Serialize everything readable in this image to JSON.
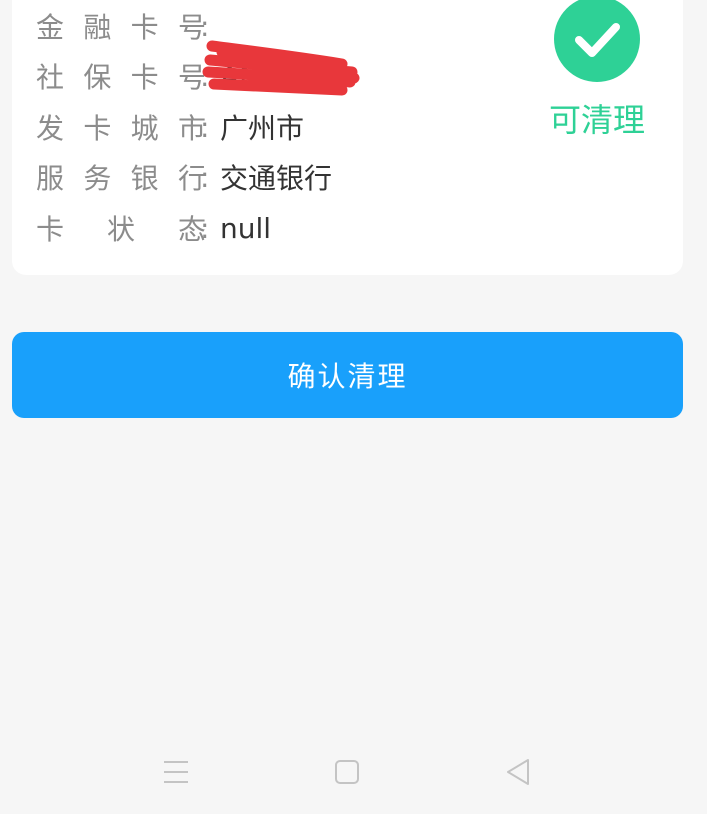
{
  "card": {
    "rows": [
      {
        "label_chars": [
          "金",
          "融",
          "卡",
          "号"
        ],
        "colon": ":",
        "value": ""
      },
      {
        "label_chars": [
          "社",
          "保",
          "卡",
          "号"
        ],
        "colon": ":",
        "value": "AN"
      },
      {
        "label_chars": [
          "发",
          "卡",
          "城",
          "市"
        ],
        "colon": ":",
        "value": "广州市"
      },
      {
        "label_chars": [
          "服",
          "务",
          "银",
          "行"
        ],
        "colon": ":",
        "value": "交通银行"
      },
      {
        "label_chars": [
          "卡",
          "状",
          "态"
        ],
        "colon": ":",
        "value": "null"
      }
    ],
    "status": {
      "icon": "check-icon",
      "text": "可清理",
      "color": "#2ed196"
    }
  },
  "confirm_button": {
    "label": "确认清理",
    "color": "#19a0fb"
  },
  "nav_bar": {
    "menu_icon": "menu-icon",
    "home_icon": "home-icon",
    "back_icon": "back-icon"
  },
  "colors": {
    "background": "#f6f6f6",
    "card": "#ffffff",
    "label": "#8c8c8c",
    "value": "#333333",
    "redaction": "#e8373b"
  }
}
